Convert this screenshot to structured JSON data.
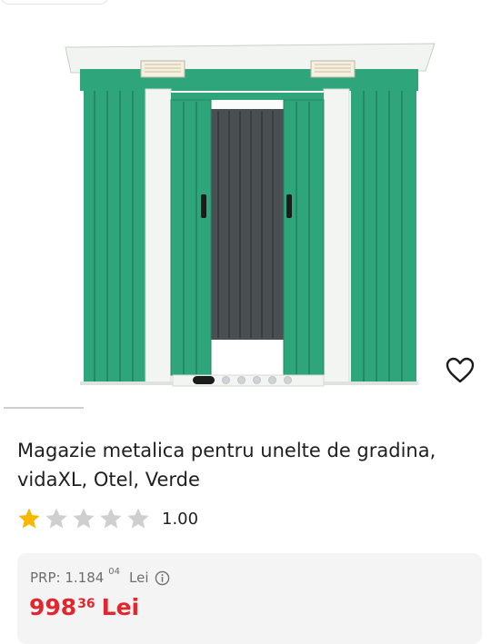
{
  "colors": {
    "accent": "#e3262e",
    "star_filled": "#f6b800",
    "star_empty": "#cfcfcf",
    "shed_green": "#2fa57b",
    "shed_white": "#f3f5f2",
    "shed_door_dark": "#4a4f52"
  },
  "icons": {
    "wishlist": "heart-outline-icon",
    "info": "info-circle-icon",
    "star": "star-icon"
  },
  "gallery": {
    "image_alt": "green metal garden shed",
    "dots_count": 6,
    "active_dot_index": 0
  },
  "product": {
    "title": "Magazie metalica pentru unelte de gradina, vidaXL, Otel, Verde",
    "rating_value": "1.00",
    "rating_stars_filled": 1,
    "rating_stars_total": 5
  },
  "pricing": {
    "rrp_label": "PRP: 1.184",
    "rrp_decimals": "04",
    "rrp_currency": "Lei",
    "price_integer": "998",
    "price_decimals": "36",
    "price_currency": "Lei"
  }
}
